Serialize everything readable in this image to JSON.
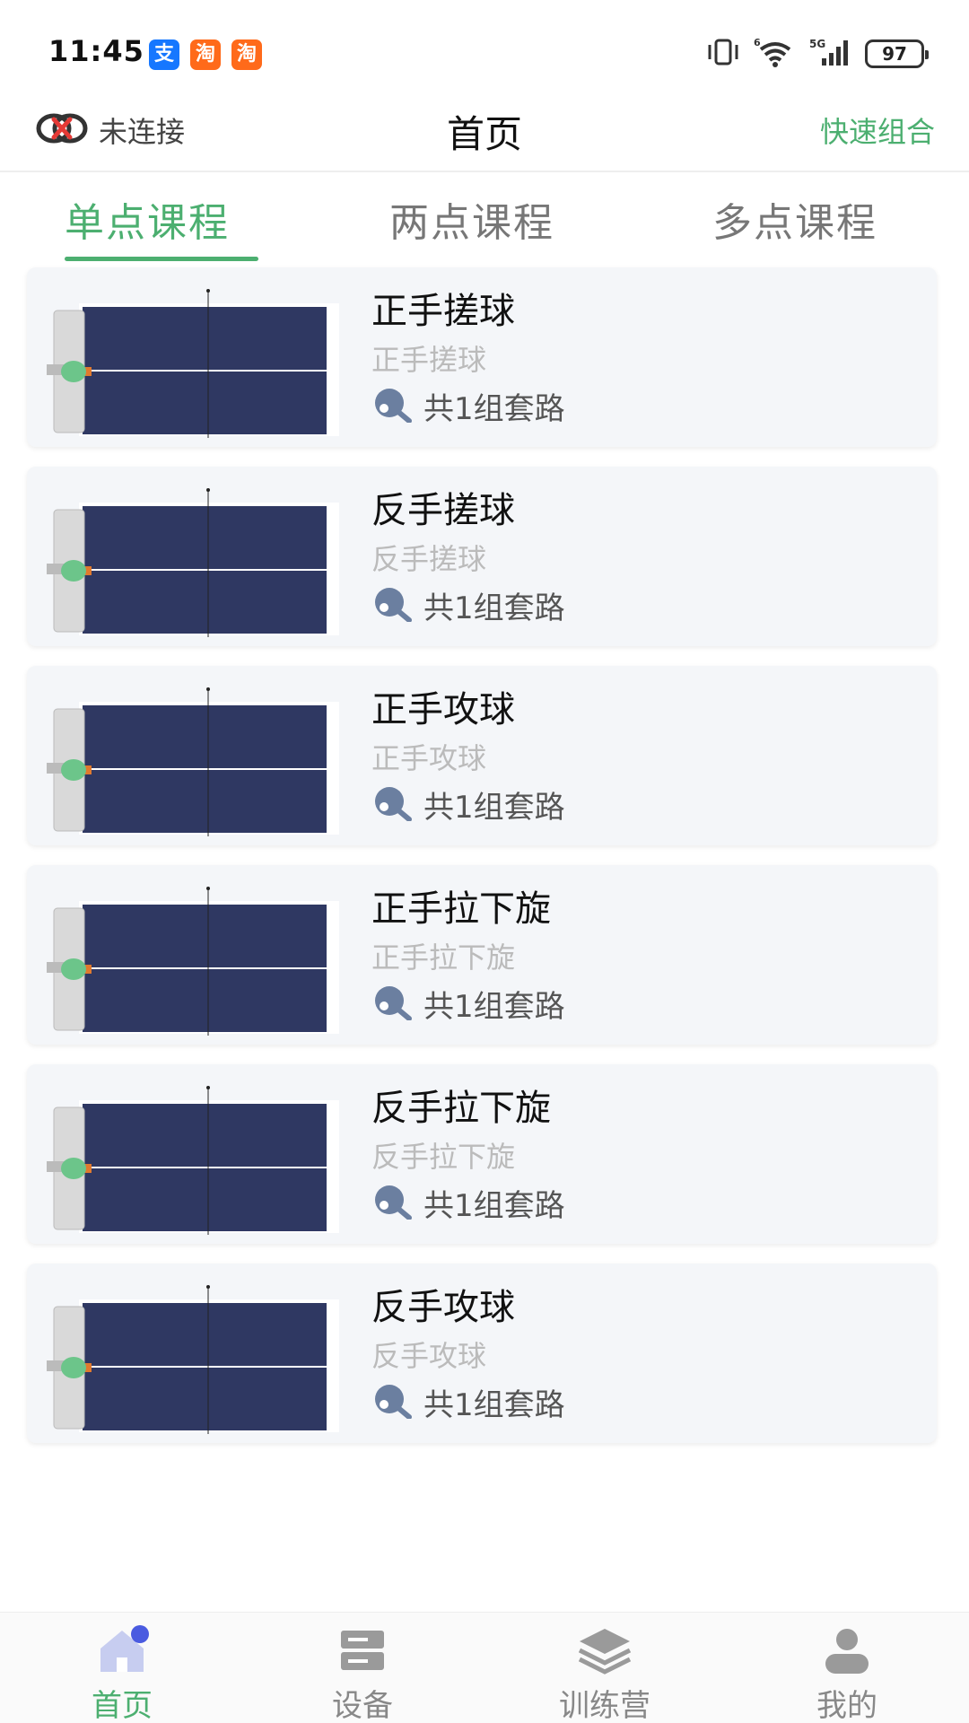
{
  "status_bar": {
    "time": "11:45",
    "apps": [
      "支",
      "淘",
      "淘"
    ],
    "network": "5G",
    "wifi_badge": "6",
    "battery": "97"
  },
  "header": {
    "connection_status": "未连接",
    "title": "首页",
    "quick_combo": "快速组合"
  },
  "tabs": [
    {
      "label": "单点课程",
      "active": true
    },
    {
      "label": "两点课程",
      "active": false
    },
    {
      "label": "多点课程",
      "active": false
    }
  ],
  "courses": [
    {
      "title": "正手搓球",
      "subtitle": "正手搓球",
      "meta": "共1组套路"
    },
    {
      "title": "反手搓球",
      "subtitle": "反手搓球",
      "meta": "共1组套路"
    },
    {
      "title": "正手攻球",
      "subtitle": "正手攻球",
      "meta": "共1组套路"
    },
    {
      "title": "正手拉下旋",
      "subtitle": "正手拉下旋",
      "meta": "共1组套路"
    },
    {
      "title": "反手拉下旋",
      "subtitle": "反手拉下旋",
      "meta": "共1组套路"
    },
    {
      "title": "反手攻球",
      "subtitle": "反手攻球",
      "meta": "共1组套路"
    }
  ],
  "bottom_nav": [
    {
      "label": "首页",
      "icon": "home-icon",
      "active": true
    },
    {
      "label": "设备",
      "icon": "device-icon",
      "active": false
    },
    {
      "label": "训练营",
      "icon": "layers-icon",
      "active": false
    },
    {
      "label": "我的",
      "icon": "profile-icon",
      "active": false
    }
  ],
  "colors": {
    "accent": "#4caf70",
    "table": "#2f3862",
    "card_bg": "#f4f6f9",
    "ball": "#6cc58a"
  }
}
